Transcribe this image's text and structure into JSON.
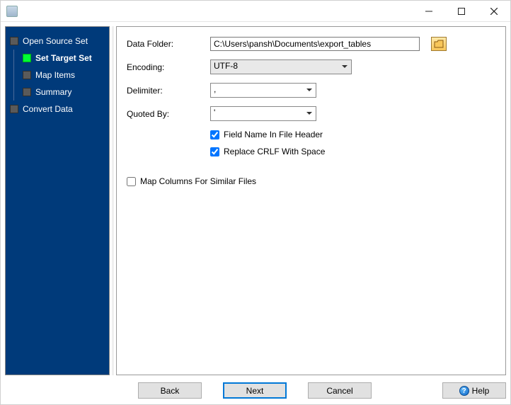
{
  "titlebar": {
    "title": ""
  },
  "sidebar": {
    "items": [
      {
        "label": "Open Source Set",
        "active": false,
        "child": false
      },
      {
        "label": "Set Target Set",
        "active": true,
        "child": true
      },
      {
        "label": "Map Items",
        "active": false,
        "child": true
      },
      {
        "label": "Summary",
        "active": false,
        "child": true
      },
      {
        "label": "Convert Data",
        "active": false,
        "child": false
      }
    ]
  },
  "form": {
    "data_folder_label": "Data Folder:",
    "data_folder_value": "C:\\Users\\pansh\\Documents\\export_tables",
    "encoding_label": "Encoding:",
    "encoding_value": "UTF-8",
    "delimiter_label": "Delimiter:",
    "delimiter_value": ",",
    "quoted_label": "Quoted By:",
    "quoted_value": "'",
    "field_name_header_label": "Field Name In File Header",
    "field_name_header_checked": true,
    "replace_crlf_label": "Replace CRLF With Space",
    "replace_crlf_checked": true,
    "map_columns_label": "Map Columns For Similar Files",
    "map_columns_checked": false
  },
  "buttons": {
    "back": "Back",
    "next": "Next",
    "cancel": "Cancel",
    "help": "Help"
  }
}
